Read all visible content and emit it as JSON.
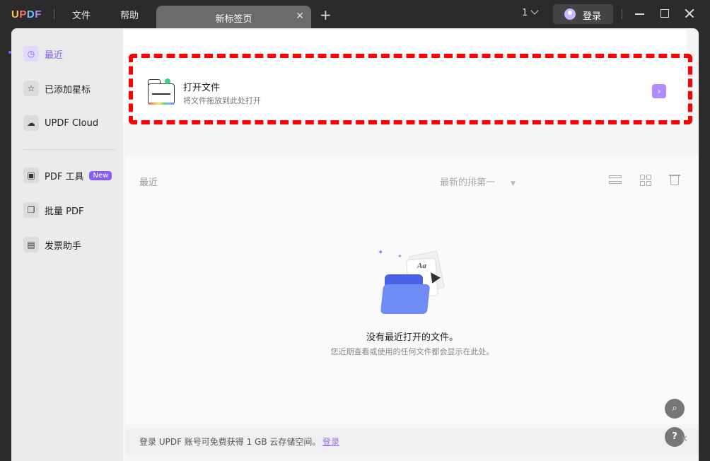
{
  "titlebar": {
    "logo": "UPDF",
    "menu": [
      "文件",
      "帮助"
    ],
    "tab_title": "新标签页",
    "page_count": "1",
    "login_label": "登录"
  },
  "sidebar": {
    "items": [
      {
        "label": "最近",
        "icon": "clock-icon",
        "active": true
      },
      {
        "label": "已添加星标",
        "icon": "star-icon"
      },
      {
        "label": "UPDF Cloud",
        "icon": "cloud-icon"
      },
      {
        "label": "PDF 工具",
        "icon": "toolbox-icon",
        "badge": "New"
      },
      {
        "label": "批量 PDF",
        "icon": "batch-icon"
      },
      {
        "label": "发票助手",
        "icon": "invoice-icon"
      }
    ]
  },
  "open_file": {
    "title": "打开文件",
    "subtitle": "将文件拖放到此处打开"
  },
  "recent": {
    "label": "最近",
    "sort": "最新的排第一",
    "empty_title": "没有最近打开的文件。",
    "empty_subtitle": "您近期查看或使用的任何文件都会显示在此处。"
  },
  "banner": {
    "text": "登录 UPDF 账号可免费获得 1 GB 云存储空间。",
    "link": "登录"
  },
  "colors": {
    "accent": "#8a5cf6",
    "highlight": "#ff0000"
  }
}
